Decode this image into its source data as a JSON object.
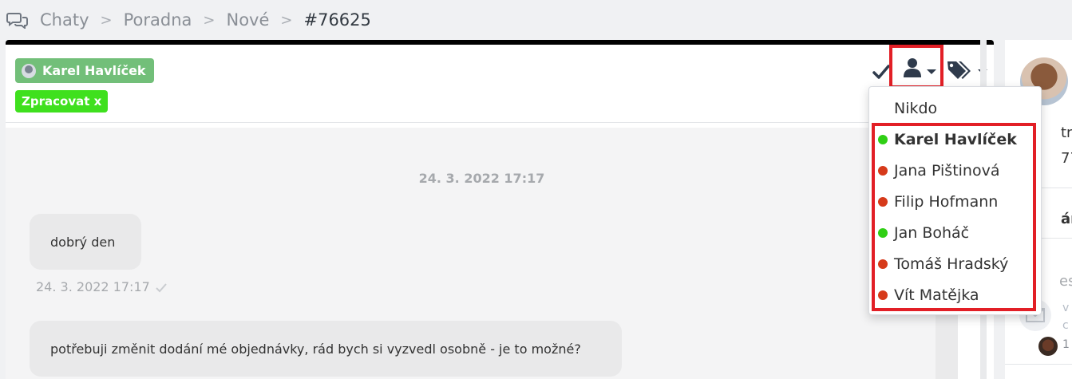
{
  "breadcrumb": {
    "icon": "chat-bubbles-icon",
    "items": [
      "Chaty",
      "Poradna",
      "Nové",
      "#76625"
    ],
    "separator": ">"
  },
  "header": {
    "agent_badge": "Karel Havlíček",
    "process_badge": "Zpracovat x"
  },
  "toolbar": {
    "icons": [
      "check-icon",
      "assign-user-icon",
      "tags-icon",
      "trash-icon"
    ]
  },
  "assign_dropdown": {
    "items": [
      {
        "label": "Nikdo",
        "status": "none",
        "selected": false
      },
      {
        "label": "Karel Havlíček",
        "status": "online",
        "selected": true
      },
      {
        "label": "Jana Pištinová",
        "status": "offline",
        "selected": false
      },
      {
        "label": "Filip Hofmann",
        "status": "offline",
        "selected": false
      },
      {
        "label": "Jan Boháč",
        "status": "online",
        "selected": false
      },
      {
        "label": "Tomáš Hradský",
        "status": "offline",
        "selected": false
      },
      {
        "label": "Vít Matějka",
        "status": "offline",
        "selected": false
      }
    ]
  },
  "conversation": {
    "date_divider": "24. 3. 2022 17:17",
    "messages": [
      {
        "text": "dobrý den",
        "time": "24. 3. 2022 17:17"
      },
      {
        "text": "potřebuji změnit dodání mé objednávky, rád bych si vyzvedl osobně - je to možné?"
      }
    ]
  },
  "right_panel": {
    "fragments": [
      "tn",
      "77",
      "ár",
      "est",
      "v",
      "c",
      "1"
    ]
  },
  "colors": {
    "agent_badge": "#72bf79",
    "process_badge": "#3fe01e",
    "online": "#2fcf14",
    "offline": "#d63a1a",
    "highlight": "#e21f26",
    "header_bar": "#000000"
  }
}
